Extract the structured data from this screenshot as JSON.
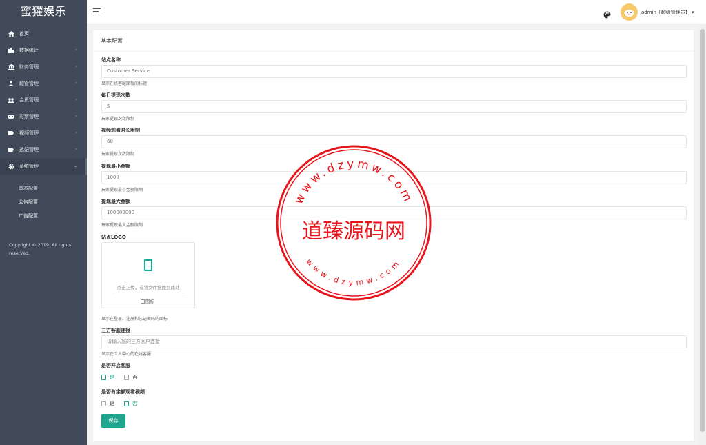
{
  "brand": "蜜獾娱乐",
  "sidebar": {
    "items": [
      {
        "label": "首页",
        "icon": "home-icon"
      },
      {
        "label": "数据统计",
        "icon": "bar-chart-icon"
      },
      {
        "label": "财务管理",
        "icon": "bank-icon"
      },
      {
        "label": "超管管理",
        "icon": "user-icon"
      },
      {
        "label": "会员管理",
        "icon": "users-icon"
      },
      {
        "label": "彩票管理",
        "icon": "ticket-icon"
      },
      {
        "label": "视频管理",
        "icon": "video-tag-icon"
      },
      {
        "label": "选妃管理",
        "icon": "tag-icon"
      },
      {
        "label": "系统管理",
        "icon": "gear-icon"
      }
    ],
    "subitems": [
      "基本配置",
      "公告配置",
      "广告配置"
    ],
    "copyright_line1": "Copyright © 2019. All rights",
    "copyright_line2": "reserved."
  },
  "header": {
    "user": "admin【超级管理员】",
    "user_caret": "▾"
  },
  "page": {
    "title": "基本配置",
    "fields": [
      {
        "label": "站点名称",
        "value": "Customer Service",
        "hint": "显示在线客服面板的标题"
      },
      {
        "label": "每日提现次数",
        "value": "5",
        "hint": "玩家提现次数限制"
      },
      {
        "label": "视频观看时长限制",
        "value": "60",
        "hint": "玩家提现次数限制"
      },
      {
        "label": "提现最小金额",
        "value": "1000",
        "hint": "玩家提现最小金额限制"
      },
      {
        "label": "提现最大金额",
        "value": "100000000",
        "hint": "玩家提现最大金额限制"
      }
    ],
    "logo": {
      "label": "站点LOGO",
      "upload_text": "点击上传，或将文件拖拽到此处",
      "image_alt": "图标",
      "hint": "显示在登录、注册和忘记密码的图标"
    },
    "third_party": {
      "label": "三方客服连接",
      "placeholder": "请输入您的三方客户连接",
      "hint": "显示在个人中心的在线客服"
    },
    "service_toggle": {
      "label": "是否开启客服",
      "options": [
        "是",
        "否"
      ],
      "selected": "是"
    },
    "extra_video": {
      "label": "是否有余额观看视频",
      "options": [
        "是",
        "否"
      ],
      "selected": "否"
    },
    "save_label": "保存"
  },
  "watermark": {
    "center": "道臻源码网",
    "top_ring": "www.dzymw.com",
    "bottom_ring": "www.dzymw.com",
    "color": "#e8141b"
  },
  "colors": {
    "accent": "#20a68f",
    "sidebar": "#404a59",
    "avatar": "#f7c96c"
  }
}
